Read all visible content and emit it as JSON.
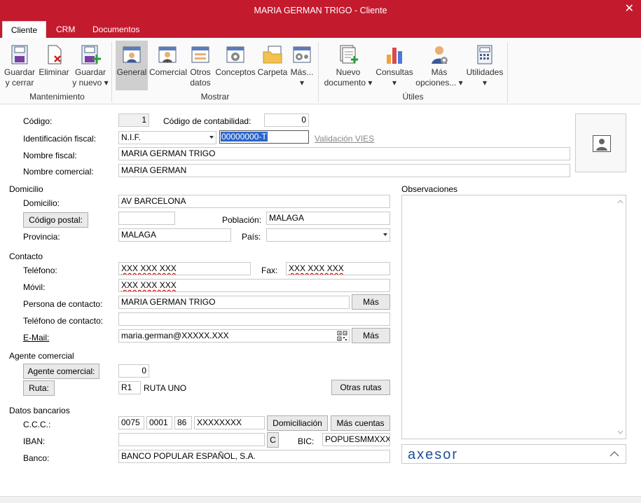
{
  "window": {
    "title": "MARIA GERMAN TRIGO - Cliente",
    "close": "✕"
  },
  "tabs": [
    {
      "label": "Cliente"
    },
    {
      "label": "CRM"
    },
    {
      "label": "Documentos"
    }
  ],
  "ribbon": {
    "buttons": [
      {
        "l1": "Guardar",
        "l2": "y cerrar"
      },
      {
        "l1": "Eliminar",
        "l2": ""
      },
      {
        "l1": "Guardar",
        "l2": "y nuevo ▾"
      },
      {
        "l1": "General",
        "l2": ""
      },
      {
        "l1": "Comercial",
        "l2": ""
      },
      {
        "l1": "Otros",
        "l2": "datos"
      },
      {
        "l1": "Conceptos",
        "l2": ""
      },
      {
        "l1": "Carpeta",
        "l2": ""
      },
      {
        "l1": "Más...",
        "l2": "▾"
      },
      {
        "l1": "Nuevo",
        "l2": "documento ▾"
      },
      {
        "l1": "Consultas",
        "l2": "▾"
      },
      {
        "l1": "Más",
        "l2": "opciones... ▾"
      },
      {
        "l1": "Utilidades",
        "l2": "▾"
      }
    ],
    "groups": [
      "Mantenimiento",
      "Mostrar",
      "Útiles"
    ]
  },
  "form": {
    "codigo_label": "Código:",
    "codigo": "1",
    "codigo_contab_label": "Código de contabilidad:",
    "codigo_contab": "0",
    "idfiscal_label": "Identificación fiscal:",
    "idfiscal_tipo": "N.I.F.",
    "idfiscal": "00000000-T",
    "vies": "Validación VIES",
    "nombre_fiscal_label": "Nombre fiscal:",
    "nombre_fiscal": "MARIA GERMAN TRIGO",
    "nombre_com_label": "Nombre comercial:",
    "nombre_com": "MARIA GERMAN",
    "domicilio_sec": "Domicilio",
    "domicilio_label": "Domicilio:",
    "domicilio": "AV BARCELONA",
    "cp_btn": "Código postal:",
    "cp": "",
    "poblacion_label": "Población:",
    "poblacion": "MALAGA",
    "provincia_label": "Provincia:",
    "provincia": "MALAGA",
    "pais_label": "País:",
    "pais": "",
    "contacto_sec": "Contacto",
    "telefono_label": "Teléfono:",
    "telefono": "XXX XXX XXX",
    "fax_label": "Fax:",
    "fax": "XXX XXX XXX",
    "movil_label": "Móvil:",
    "movil": "XXX XXX XXX",
    "persona_label": "Persona de contacto:",
    "persona": "MARIA GERMAN TRIGO",
    "mas1": "Más",
    "tel_contacto_label": "Teléfono de contacto:",
    "tel_contacto": "",
    "email_label": "E-Mail:",
    "email": "maria.german@XXXXX.XXX",
    "mas2": "Más",
    "agente_sec": "Agente comercial",
    "agente_btn": "Agente comercial:",
    "agente": "0",
    "ruta_btn": "Ruta:",
    "ruta_cod": "R1",
    "ruta_nombre": "RUTA UNO",
    "otras_rutas": "Otras rutas",
    "banco_sec": "Datos bancarios",
    "ccc_label": "C.C.C.:",
    "ccc1": "0075",
    "ccc2": "0001",
    "ccc3": "86",
    "ccc4": "XXXXXXXX",
    "domiciliacion": "Domiciliación",
    "mas_cuentas": "Más cuentas",
    "iban_label": "IBAN:",
    "iban": "",
    "iban_btn": "C",
    "bic_label": "BIC:",
    "bic": "POPUESMMXXX",
    "banco_label": "Banco:",
    "banco": "BANCO POPULAR ESPAÑOL, S.A.",
    "obs_label": "Observaciones",
    "obs": "",
    "axesor": "axesor"
  },
  "colors": {
    "accent": "#c41a2e",
    "axesor_blue": "#1f4e9c",
    "axesor_orange": "#e86a1a"
  }
}
